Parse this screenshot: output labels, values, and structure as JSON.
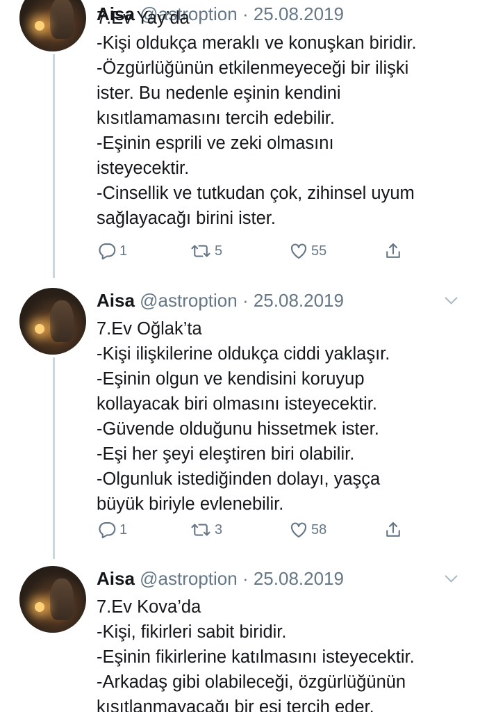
{
  "tweets": [
    {
      "name": "Aisa",
      "handle": "@astroption",
      "date": "25.08.2019",
      "lines": [
        "7.Ev Yay’da",
        "-Kişi oldukça meraklı ve konuşkan biridir.",
        "-Özgürlüğünün etkilenmeyeceği bir ilişki",
        "ister. Bu nedenle eşinin kendini",
        "kısıtlamamasını tercih edebilir.",
        "-Eşinin esprili ve zeki olmasını",
        "isteyecektir.",
        "-Cinsellik ve tutkudan çok, zihinsel uyum",
        "sağlayacağı birini ister."
      ],
      "reply_count": "1",
      "retweet_count": "5",
      "like_count": "55"
    },
    {
      "name": "Aisa",
      "handle": "@astroption",
      "date": "25.08.2019",
      "lines": [
        "7.Ev Oğlak’ta",
        "-Kişi ilişkilerine oldukça ciddi yaklaşır.",
        "-Eşinin olgun ve kendisini koruyup",
        "kollayacak biri olmasını isteyecektir.",
        "-Güvende olduğunu hissetmek ister.",
        "-Eşi her şeyi eleştiren biri olabilir.",
        "-Olgunluk istediğinden dolayı, yaşça",
        "büyük biriyle evlenebilir."
      ],
      "reply_count": "1",
      "retweet_count": "3",
      "like_count": "58"
    },
    {
      "name": "Aisa",
      "handle": "@astroption",
      "date": "25.08.2019",
      "lines": [
        "7.Ev Kova’da",
        "-Kişi, fikirleri sabit biridir.",
        "-Eşinin fikirlerine katılmasını isteyecektir.",
        "-Arkadaş gibi olabileceği, özgürlüğünün",
        "kısıtlanmayacağı bir eşi tercih eder."
      ]
    }
  ],
  "icons": {
    "reply": "reply-icon",
    "retweet": "retweet-icon",
    "like": "heart-icon",
    "share": "share-icon",
    "menu": "chevron-down-icon"
  },
  "colors": {
    "text": "#14171a",
    "secondary": "#657786",
    "thread_line": "#ccd6dd"
  }
}
